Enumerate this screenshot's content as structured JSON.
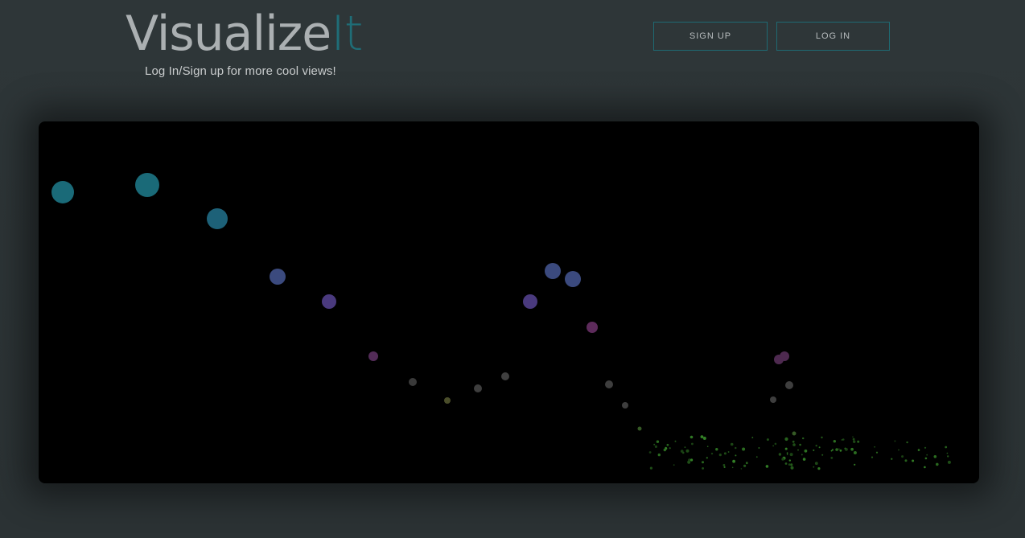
{
  "header": {
    "brand_main": "Visualize",
    "brand_accent": "It",
    "tagline": "Log In/Sign up for more cool views!"
  },
  "auth": {
    "signup_label": "SIGN UP",
    "login_label": "LOG IN"
  },
  "colors": {
    "background": "#2c3335",
    "accent": "#1f6d77",
    "canvas": "#000000"
  }
}
